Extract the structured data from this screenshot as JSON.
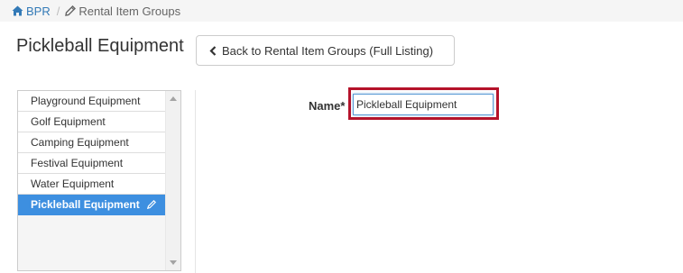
{
  "breadcrumb": {
    "home_label": "BPR",
    "current_label": "Rental Item Groups",
    "separator": "/"
  },
  "page": {
    "title": "Pickleball Equipment"
  },
  "toolbar": {
    "back_label": "Back to Rental Item Groups (Full Listing)"
  },
  "groups": [
    {
      "label": "Playground Equipment",
      "active": false
    },
    {
      "label": "Golf Equipment",
      "active": false
    },
    {
      "label": "Camping Equipment",
      "active": false
    },
    {
      "label": "Festival Equipment",
      "active": false
    },
    {
      "label": "Water Equipment",
      "active": false
    },
    {
      "label": "Pickleball Equipment",
      "active": true
    }
  ],
  "form": {
    "name_label": "Name",
    "required_mark": "*",
    "name_value": "Pickleball Equipment"
  },
  "icons": {
    "home": "home-icon",
    "breadcrumb_edit": "pencil-icon",
    "back": "chevron-left-icon",
    "item_edit": "pencil-icon"
  },
  "colors": {
    "link": "#337ab7",
    "active_item": "#3d8fe0",
    "highlight": "#b5122a",
    "input_focus": "#5b9bd5"
  }
}
